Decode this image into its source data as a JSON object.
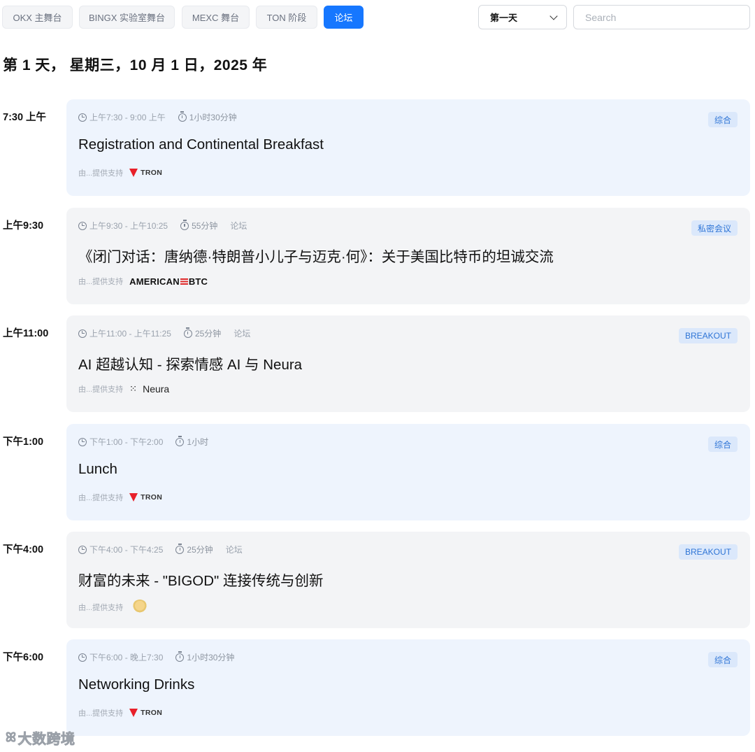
{
  "tabs": [
    {
      "label": "OKX 主舞台",
      "active": false
    },
    {
      "label": "BINGX 实验室舞台",
      "active": false
    },
    {
      "label": "MEXC 舞台",
      "active": false
    },
    {
      "label": "TON 阶段",
      "active": false
    },
    {
      "label": "论坛",
      "active": true
    }
  ],
  "day_select": {
    "value": "第一天"
  },
  "search": {
    "placeholder": "Search",
    "value": ""
  },
  "day_title": "第 1 天， 星期三，10 月 1 日，2025 年",
  "sponsor_prefix": "由...提供支持",
  "events": [
    {
      "time": "7:30 上午",
      "range": "上午7:30 - 9:00 上午",
      "duration": "1小时30分钟",
      "venue": "",
      "badge": "综合",
      "title": "Registration and Continental Breakfast",
      "sponsor": "TRON",
      "sponsor_logo": "tron-logo",
      "bg": "blue"
    },
    {
      "time": "上午9:30",
      "range": "上午9:30 - 上午10:25",
      "duration": "55分钟",
      "venue": "论坛",
      "badge": "私密会议",
      "title": "《闭门对话：唐纳德·特朗普小儿子与迈克·何》：关于美国比特币的坦诚交流",
      "sponsor": "AMERICAN≡BTC",
      "sponsor_logo": "american-btc-logo",
      "bg": "gray"
    },
    {
      "time": "上午11:00",
      "range": "上午11:00 - 上午11:25",
      "duration": "25分钟",
      "venue": "论坛",
      "badge": "BREAKOUT",
      "title": "AI 超越认知 - 探索情感 AI 与 Neura",
      "sponsor": "Neura",
      "sponsor_logo": "neura-logo",
      "bg": "gray"
    },
    {
      "time": "下午1:00",
      "range": "下午1:00 - 下午2:00",
      "duration": "1小时",
      "venue": "",
      "badge": "综合",
      "title": "Lunch",
      "sponsor": "TRON",
      "sponsor_logo": "tron-logo",
      "bg": "blue"
    },
    {
      "time": "下午4:00",
      "range": "下午4:00 - 下午4:25",
      "duration": "25分钟",
      "venue": "论坛",
      "badge": "BREAKOUT",
      "title": "财富的未来 - \"BIGOD\" 连接传统与创新",
      "sponsor": "",
      "sponsor_logo": "bigod-logo",
      "bg": "gray"
    },
    {
      "time": "下午6:00",
      "range": "下午6:00 - 晚上7:30",
      "duration": "1小时30分钟",
      "venue": "",
      "badge": "综合",
      "title": "Networking Drinks",
      "sponsor": "TRON",
      "sponsor_logo": "tron-logo",
      "bg": "blue"
    }
  ],
  "watermark": "大数跨境"
}
